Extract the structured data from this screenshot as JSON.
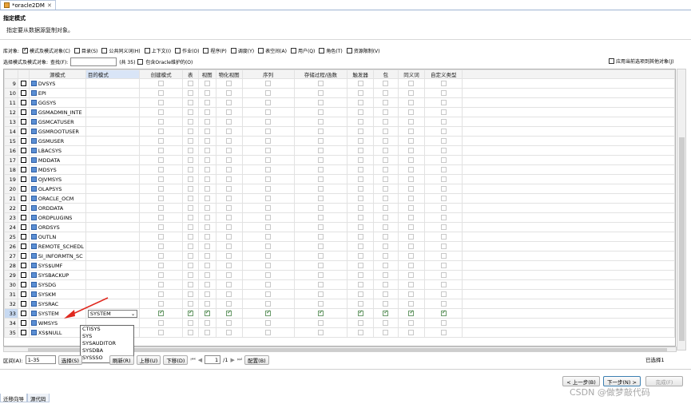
{
  "editor_tab": {
    "title": "*oracle2DM",
    "close": "✕"
  },
  "header": {
    "title": "指定模式",
    "description": "指定要从数据源复制对象。"
  },
  "object_types": {
    "label": "库对象:",
    "items": [
      {
        "label": "模式及模式对象(C)",
        "checked": true
      },
      {
        "label": "目录(S)",
        "checked": false
      },
      {
        "label": "公共同义词(H)",
        "checked": false
      },
      {
        "label": "上下文(I)",
        "checked": false
      },
      {
        "label": "作业(O)",
        "checked": false
      },
      {
        "label": "程序(P)",
        "checked": false
      },
      {
        "label": "调度(Y)",
        "checked": false
      },
      {
        "label": "表空间(A)",
        "checked": false
      },
      {
        "label": "用户(Q)",
        "checked": false
      },
      {
        "label": "角色(T)",
        "checked": false
      },
      {
        "label": "资源限制(V)",
        "checked": false
      }
    ]
  },
  "filter": {
    "label": "选择模式及模式对象:",
    "search_label": "查找(F):",
    "search_value": "",
    "count": "(共 35)",
    "include_oracle": "包含Oracle维护的(O)",
    "apply_other": "应用当前选项到其他对象(J)"
  },
  "columns": [
    "",
    "",
    "源模式",
    "目的模式",
    "创建模式",
    "表",
    "视图",
    "物化视图",
    "序列",
    "存储过程/函数",
    "触发器",
    "包",
    "同义词",
    "自定义类型"
  ],
  "rows": [
    {
      "n": "9",
      "src": "DVSYS",
      "dst": "",
      "on": false
    },
    {
      "n": "10",
      "src": "EPI",
      "dst": "",
      "on": false
    },
    {
      "n": "11",
      "src": "GGSYS",
      "dst": "",
      "on": false
    },
    {
      "n": "12",
      "src": "GSMADMIN_INTE",
      "dst": "",
      "on": false
    },
    {
      "n": "13",
      "src": "GSMCATUSER",
      "dst": "",
      "on": false
    },
    {
      "n": "14",
      "src": "GSMROOTUSER",
      "dst": "",
      "on": false
    },
    {
      "n": "15",
      "src": "GSMUSER",
      "dst": "",
      "on": false
    },
    {
      "n": "16",
      "src": "LBACSYS",
      "dst": "",
      "on": false
    },
    {
      "n": "17",
      "src": "MDDATA",
      "dst": "",
      "on": false
    },
    {
      "n": "18",
      "src": "MDSYS",
      "dst": "",
      "on": false
    },
    {
      "n": "19",
      "src": "OJVMSYS",
      "dst": "",
      "on": false
    },
    {
      "n": "20",
      "src": "OLAPSYS",
      "dst": "",
      "on": false
    },
    {
      "n": "21",
      "src": "ORACLE_OCM",
      "dst": "",
      "on": false
    },
    {
      "n": "22",
      "src": "ORDDATA",
      "dst": "",
      "on": false
    },
    {
      "n": "23",
      "src": "ORDPLUGINS",
      "dst": "",
      "on": false
    },
    {
      "n": "24",
      "src": "ORDSYS",
      "dst": "",
      "on": false
    },
    {
      "n": "25",
      "src": "OUTLN",
      "dst": "",
      "on": false
    },
    {
      "n": "26",
      "src": "REMOTE_SCHEDL",
      "dst": "",
      "on": false
    },
    {
      "n": "27",
      "src": "SI_INFORMTN_SC",
      "dst": "",
      "on": false
    },
    {
      "n": "28",
      "src": "SYS$UMF",
      "dst": "",
      "on": false
    },
    {
      "n": "29",
      "src": "SYSBACKUP",
      "dst": "",
      "on": false
    },
    {
      "n": "30",
      "src": "SYSDG",
      "dst": "",
      "on": false
    },
    {
      "n": "31",
      "src": "SYSKM",
      "dst": "",
      "on": false
    },
    {
      "n": "32",
      "src": "SYSRAC",
      "dst": "",
      "on": false
    },
    {
      "n": "33",
      "src": "SYSTEM",
      "dst": "SYSTEM",
      "on": true
    },
    {
      "n": "34",
      "src": "WMSYS",
      "dst": "",
      "on": false
    },
    {
      "n": "35",
      "src": "XS$NULL",
      "dst": "",
      "on": false
    }
  ],
  "dropdown_options": [
    "CTISYS",
    "SYS",
    "SYSAUDITOR",
    "SYSDBA",
    "SYSSSO"
  ],
  "bottom": {
    "range_label": "区间(A):",
    "range_value": "1-35",
    "select": "选择(S)",
    "refresh": "刷新(R)",
    "up": "上移(U)",
    "down": "下移(D)",
    "page": "1",
    "page_total": "/1",
    "config": "配置(B)",
    "selected": "已选择1"
  },
  "footer": {
    "prev": "< 上一步(B)",
    "next": "下一步(N) >",
    "finish": "完成(F)"
  },
  "bottom_tabs": [
    "迁移向导",
    "源代码"
  ],
  "watermark": "CSDN @做梦敲代码",
  "colors": {
    "selected_row": "#c7d9f1",
    "arrow": "#e0281e",
    "check": "#1c6a1c"
  }
}
